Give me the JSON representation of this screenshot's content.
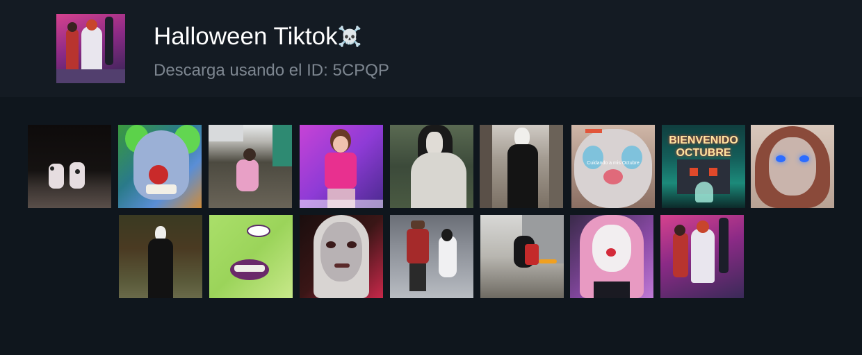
{
  "header": {
    "title": "Halloween Tiktok",
    "title_emoji": "☠️",
    "subtitle": "Descarga usando el ID: 5CPQP"
  },
  "tiles": [
    {
      "name": "dancing-cow-costumes",
      "text": ""
    },
    {
      "name": "clown-face-closeup",
      "text": ""
    },
    {
      "name": "girl-in-driveway",
      "text": ""
    },
    {
      "name": "girl-pink-shirt",
      "text": ""
    },
    {
      "name": "ghost-figure-lawn",
      "text": ""
    },
    {
      "name": "ghostface-dancing",
      "text": ""
    },
    {
      "name": "clown-makeup-woman",
      "text": "Cuidando a mis Octubre"
    },
    {
      "name": "bienvenido-octubre-haunted-house",
      "text": "BIENVENIDO OCTUBRE"
    },
    {
      "name": "creepy-doll-blue-eyes",
      "text": ""
    },
    {
      "name": "ghostface-in-woods",
      "text": ""
    },
    {
      "name": "green-witch-makeup",
      "text": ""
    },
    {
      "name": "nun-makeup",
      "text": ""
    },
    {
      "name": "freddy-and-ghost-girl",
      "text": ""
    },
    {
      "name": "cat-with-cape",
      "text": ""
    },
    {
      "name": "pink-hair-clown",
      "text": ""
    },
    {
      "name": "pennywise-kid-pink-room",
      "text": ""
    }
  ]
}
